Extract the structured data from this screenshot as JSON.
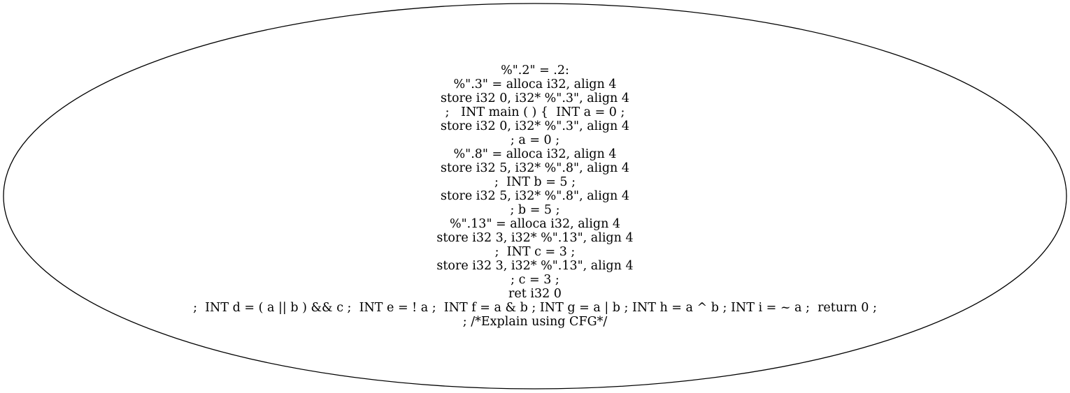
{
  "graph": {
    "node": {
      "shape": "ellipse",
      "stroke_color": "#000000",
      "fill_color": "#ffffff",
      "lines": [
        "%\".2\" = .2:",
        "%\".3\" = alloca i32, align 4",
        "store i32 0, i32* %\".3\", align 4",
        ";   INT main ( ) {  INT a = 0 ;",
        "store i32 0, i32* %\".3\", align 4",
        "; a = 0 ;",
        "%\".8\" = alloca i32, align 4",
        "store i32 5, i32* %\".8\", align 4",
        ";  INT b = 5 ;",
        "store i32 5, i32* %\".8\", align 4",
        "; b = 5 ;",
        "%\".13\" = alloca i32, align 4",
        "store i32 3, i32* %\".13\", align 4",
        ";  INT c = 3 ;",
        "store i32 3, i32* %\".13\", align 4",
        "; c = 3 ;",
        "ret i32 0",
        ";  INT d = ( a || b ) && c ;  INT e = ! a ;  INT f = a & b ; INT g = a | b ; INT h = a ^ b ; INT i = ~ a ;  return 0 ;",
        "; /*Explain using CFG*/"
      ]
    }
  }
}
